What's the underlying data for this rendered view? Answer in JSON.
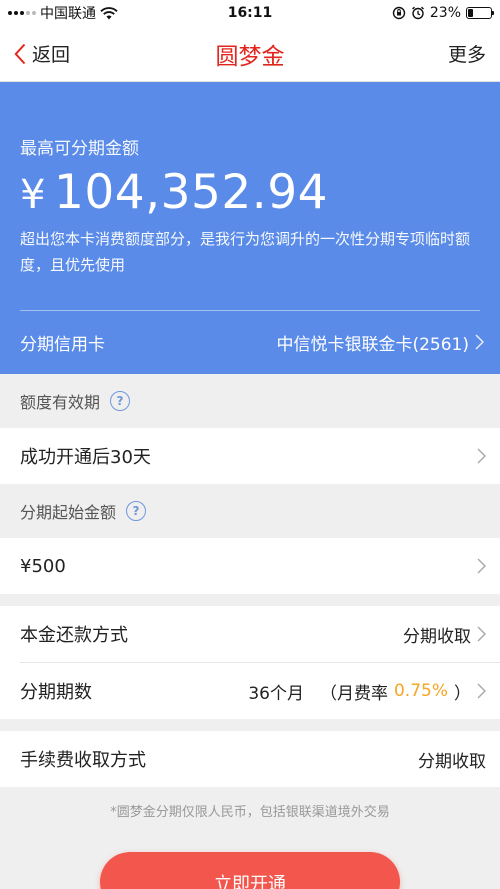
{
  "status_bar": {
    "carrier": "中国联通",
    "time": "16:11",
    "battery": "23%",
    "battery_level": 0.23
  },
  "nav": {
    "back_label": "返回",
    "title": "圆梦金",
    "more_label": "更多"
  },
  "hero": {
    "label": "最高可分期金额",
    "currency": "¥",
    "amount": "104,352.94",
    "description": "超出您本卡消费额度部分，是我行为您调升的一次性分期专项临时额度，且优先使用",
    "card_label": "分期信用卡",
    "card_value": "中信悦卡银联金卡(2561)"
  },
  "validity": {
    "header": "额度有效期",
    "value": "成功开通后30天"
  },
  "start_amount": {
    "header": "分期起始金额",
    "value": "¥500"
  },
  "repayment": {
    "method_label": "本金还款方式",
    "method_value": "分期收取",
    "periods_label": "分期期数",
    "periods_value": "36个月",
    "rate_prefix": "（月费率",
    "rate_value": "0.75%",
    "rate_suffix": "）"
  },
  "fee": {
    "label": "手续费收取方式",
    "value": "分期收取"
  },
  "footnote": "*圆梦金分期仅限人民币，包括银联渠道境外交易",
  "cta_label": "立即开通",
  "colors": {
    "accent_red": "#e2261e",
    "hero_blue": "#5a8be8",
    "rate_orange": "#f5a623",
    "button_red": "#f2564c"
  }
}
